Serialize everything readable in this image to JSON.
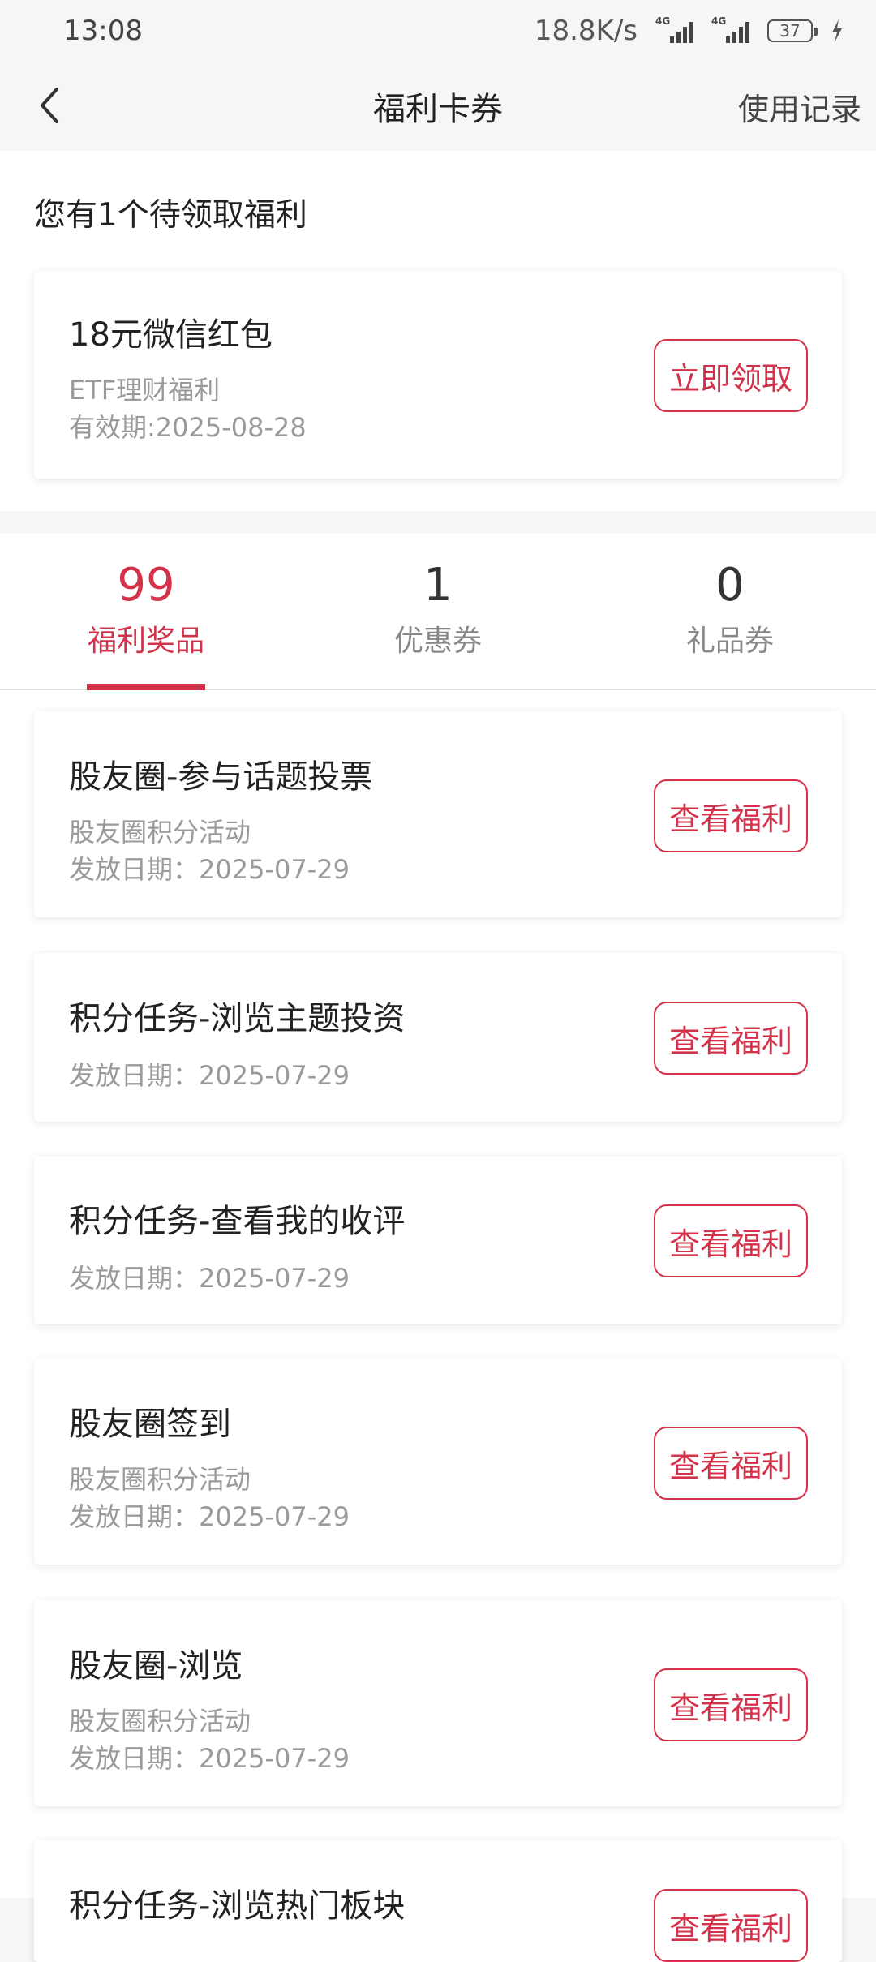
{
  "status_bar": {
    "time": "13:08",
    "network_speed": "18.8K/s",
    "signal_tag_1": "4G",
    "signal_tag_2": "4G",
    "battery": "37"
  },
  "header": {
    "title": "福利卡券",
    "usage_link": "使用记录"
  },
  "pending": {
    "title": "您有1个待领取福利",
    "card": {
      "title": "18元微信红包",
      "line1": "ETF理财福利",
      "line2": "有效期:2025-08-28",
      "button": "立即领取"
    }
  },
  "tabs": [
    {
      "count": "99",
      "label": "福利奖品",
      "active": true
    },
    {
      "count": "1",
      "label": "优惠券",
      "active": false
    },
    {
      "count": "0",
      "label": "礼品券",
      "active": false
    }
  ],
  "accent_color": "#d4324a",
  "items": [
    {
      "title": "股友圈-参与话题投票",
      "source": "股友圈积分活动",
      "date": "发放日期：2025-07-29",
      "button": "查看福利"
    },
    {
      "title": "积分任务-浏览主题投资",
      "date": "发放日期：2025-07-29",
      "button": "查看福利"
    },
    {
      "title": "积分任务-查看我的收评",
      "date": "发放日期：2025-07-29",
      "button": "查看福利"
    },
    {
      "title": "股友圈签到",
      "source": "股友圈积分活动",
      "date": "发放日期：2025-07-29",
      "button": "查看福利"
    },
    {
      "title": "股友圈-浏览",
      "source": "股友圈积分活动",
      "date": "发放日期：2025-07-29",
      "button": "查看福利"
    },
    {
      "title": "积分任务-浏览热门板块",
      "button": "查看福利"
    }
  ]
}
